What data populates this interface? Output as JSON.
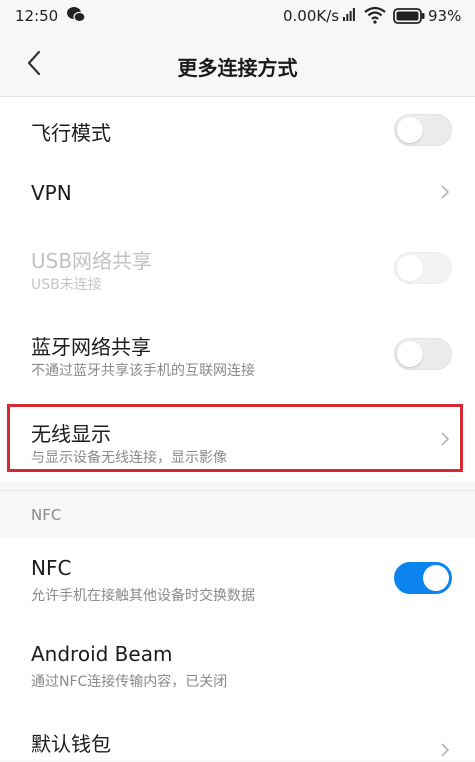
{
  "status_bar": {
    "time": "12:50",
    "network_speed": "0.00K/s",
    "battery": "93%"
  },
  "header": {
    "title": "更多连接方式"
  },
  "settings": [
    {
      "label": "飞行模式",
      "subtitle": "",
      "control": "toggle",
      "state": "off"
    },
    {
      "label": "VPN",
      "subtitle": "",
      "control": "chevron"
    },
    {
      "label": "USB网络共享",
      "subtitle": "USB未连接",
      "control": "toggle",
      "state": "disabled"
    },
    {
      "label": "蓝牙网络共享",
      "subtitle": "不通过蓝牙共享该手机的互联网连接",
      "control": "toggle",
      "state": "off"
    },
    {
      "label": "无线显示",
      "subtitle": "与显示设备无线连接，显示影像",
      "control": "chevron",
      "highlighted": true
    }
  ],
  "nfc_section": {
    "header": "NFC",
    "items": [
      {
        "label": "NFC",
        "subtitle": "允许手机在接触其他设备时交换数据",
        "control": "toggle",
        "state": "on"
      },
      {
        "label": "Android Beam",
        "subtitle": "通过NFC连接传输内容，已关闭",
        "control": "none"
      },
      {
        "label": "默认钱包",
        "subtitle": "",
        "control": "chevron"
      }
    ]
  },
  "colors": {
    "accent": "#0b84ef",
    "highlight_border": "#d42a33"
  }
}
